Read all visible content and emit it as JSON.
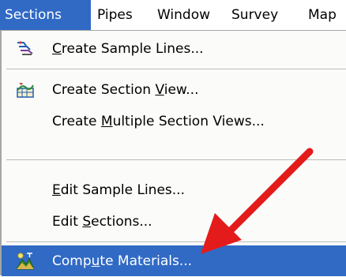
{
  "menubar": {
    "items": [
      {
        "label": "Sections",
        "active": true
      },
      {
        "label": "Pipes"
      },
      {
        "label": "Window"
      },
      {
        "label": "Survey"
      },
      {
        "label": "Map"
      }
    ]
  },
  "menu": {
    "items": [
      {
        "mnemonic": "C",
        "rest": "reate Sample Lines...",
        "icon": "sample-lines-icon"
      },
      {
        "before": "Create Section ",
        "mnemonic": "V",
        "rest": "iew...",
        "icon": "section-view-icon"
      },
      {
        "before": "Create ",
        "mnemonic": "M",
        "rest": "ultiple Section Views..."
      },
      {
        "mnemonic": "E",
        "rest": "dit Sample Lines..."
      },
      {
        "before": "Edit ",
        "mnemonic": "S",
        "rest": "ections..."
      },
      {
        "before": "Comp",
        "mnemonic": "u",
        "rest": "te Materials...",
        "icon": "compute-materials-icon",
        "highlighted": true
      }
    ]
  },
  "colors": {
    "highlight": "#316ac5",
    "menu_background": "#fbfbf9",
    "arrow": "#e31b1b"
  }
}
